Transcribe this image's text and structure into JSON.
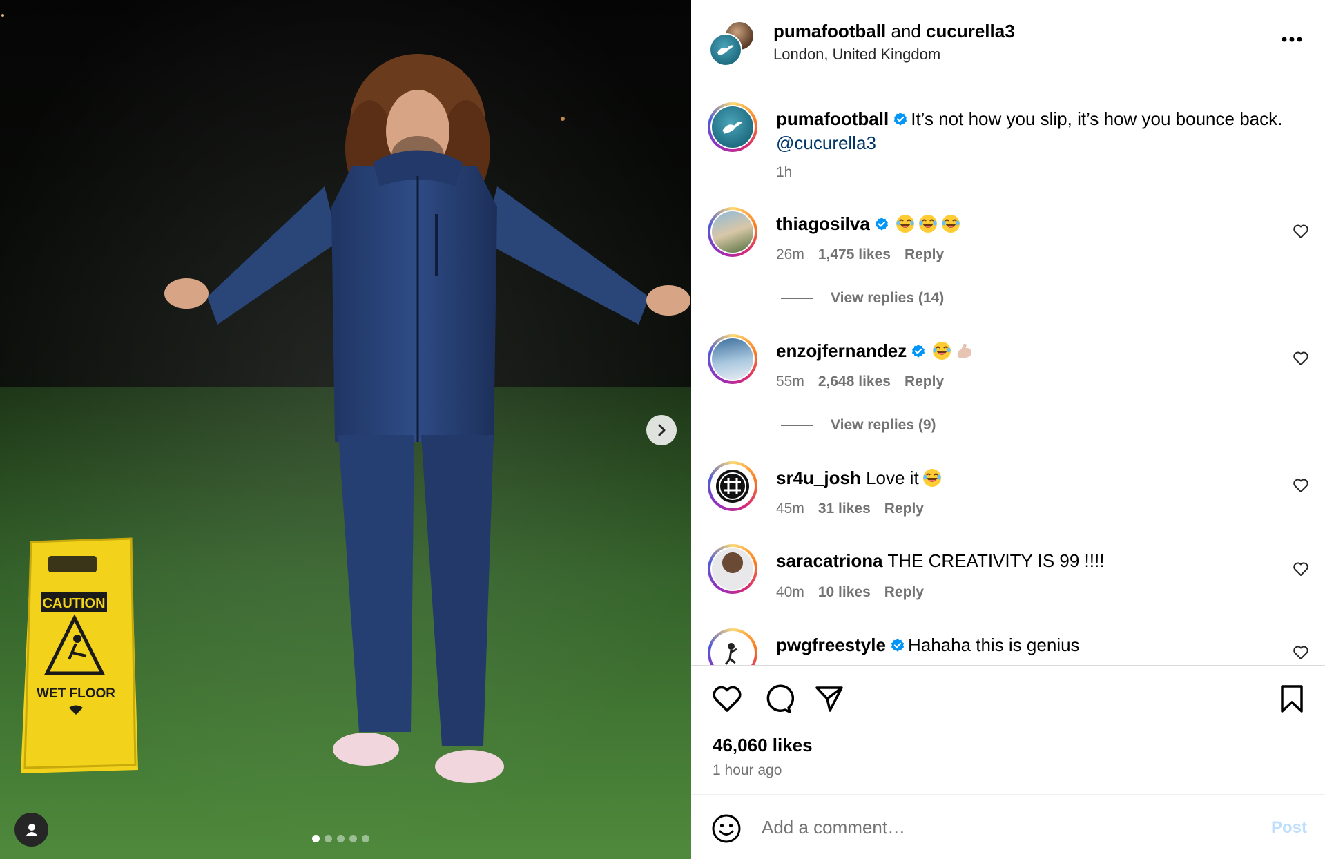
{
  "media": {
    "sign_text_top": "CAUTION",
    "sign_text_bottom": "WET FLOOR",
    "slide_count": 5,
    "active_slide": 1
  },
  "header": {
    "author": "pumafootball",
    "connector": " and ",
    "collaborator": "cucurella3",
    "location": "London, United Kingdom"
  },
  "caption": {
    "user": "pumafootball",
    "verified": true,
    "text": "It’s not how you slip, it’s how you bounce back.",
    "mention": "@cucurella3",
    "time": "1h"
  },
  "comments": [
    {
      "user": "thiagosilva",
      "verified": true,
      "text": "",
      "emojis": [
        "laughing",
        "laughing",
        "laughing"
      ],
      "time": "26m",
      "likes": "1,475 likes",
      "reply_label": "Reply",
      "view_replies": "View replies (14)"
    },
    {
      "user": "enzojfernandez",
      "verified": true,
      "text": "",
      "emojis": [
        "laughing",
        "flexed-biceps"
      ],
      "time": "55m",
      "likes": "2,648 likes",
      "reply_label": "Reply",
      "view_replies": "View replies (9)"
    },
    {
      "user": "sr4u_josh",
      "verified": false,
      "text": "Love it",
      "emojis": [
        "laughing"
      ],
      "time": "45m",
      "likes": "31 likes",
      "reply_label": "Reply"
    },
    {
      "user": "saracatriona",
      "verified": false,
      "text": "THE CREATIVITY IS 99 !!!!",
      "time": "40m",
      "likes": "10 likes",
      "reply_label": "Reply"
    },
    {
      "user": "pwgfreestyle",
      "verified": true,
      "text": "Hahaha this is genius"
    }
  ],
  "actions": {
    "likes": "46,060 likes",
    "time_ago": "1 hour ago"
  },
  "add_comment": {
    "placeholder": "Add a comment…",
    "post_label": "Post"
  },
  "colors": {
    "verified": "#0095f6",
    "muted": "#737373",
    "post_disabled": "#c0dffd",
    "mention": "#00376b"
  }
}
